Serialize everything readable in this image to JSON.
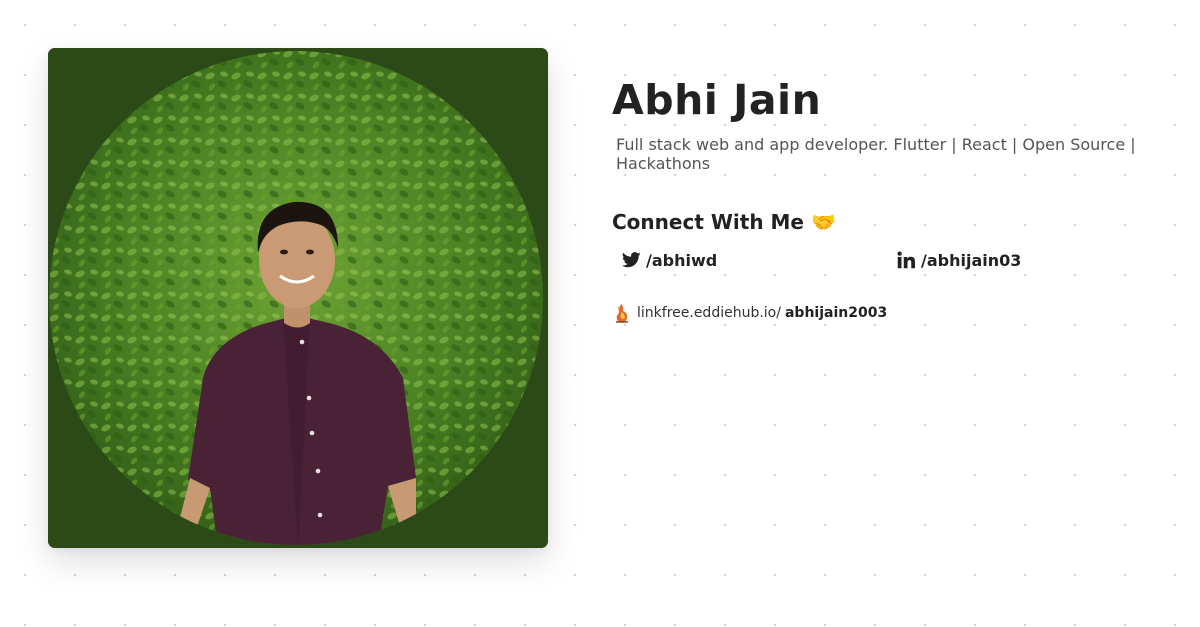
{
  "profile": {
    "name": "Abhi Jain",
    "bio": "Full stack web and app developer. Flutter | React | Open Source | Hackathons",
    "photo_alt": "profile-photo"
  },
  "connect": {
    "heading": "Connect With Me 🤝",
    "twitter": {
      "handle": "/abhiwd",
      "icon": "twitter-bird-icon"
    },
    "linkedin": {
      "handle": "/abhijain03",
      "icon": "linkedin-icon"
    }
  },
  "linkfree": {
    "domain": "linkfree.eddiehub.io/",
    "username": "abhijain2003",
    "icon": "linkfree-logo-icon"
  },
  "colors": {
    "background": "#ffffff",
    "dot_grid": "#cfcfcf",
    "text_primary": "#222222",
    "text_secondary": "#555555",
    "photo_border": "#2c4a18"
  }
}
